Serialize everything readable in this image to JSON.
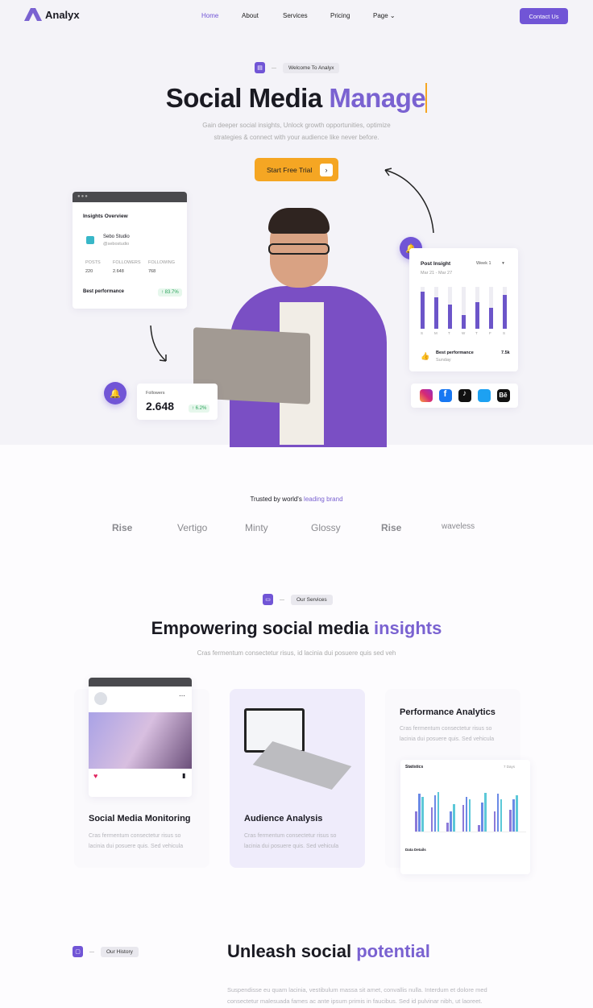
{
  "nav": {
    "brand": "Analyx",
    "items": [
      "Home",
      "About",
      "Services",
      "Pricing",
      "Page"
    ],
    "contact": "Contact Us"
  },
  "hero": {
    "badge": "Welcome To Analyx",
    "title_dark": "Social Media ",
    "title_accent": "Manage",
    "subtitle_line1": "Gain deeper social insights, Unlock growth opportunities, optimize",
    "subtitle_line2": "strategies & connect with your audience like never before.",
    "cta": "Start Free Trial"
  },
  "insights": {
    "title": "Insights Overview",
    "account": "Sebo Studio",
    "handle": "@sebostudio",
    "stats": [
      {
        "label": "POSTS",
        "value": "220"
      },
      {
        "label": "FOLLOWERS",
        "value": "2.648"
      },
      {
        "label": "FOLLOWING",
        "value": "768"
      }
    ],
    "best_label": "Best performance",
    "best_value": "↑ 83.7%"
  },
  "followers": {
    "label": "Followers",
    "value": "2.648",
    "change": "↑ 6.2%"
  },
  "post_insight": {
    "title": "Post Insight",
    "period": "Week 1",
    "dates": "Mar 21 - Mar 27",
    "days": [
      "S",
      "M",
      "T",
      "W",
      "T",
      "F",
      "S"
    ],
    "values": [
      0.88,
      0.75,
      0.58,
      0.32,
      0.64,
      0.5,
      0.8
    ],
    "best_label": "Best performance",
    "best_day": "Sunday",
    "best_value": "7.5k"
  },
  "social": [
    "Instagram",
    "Facebook",
    "TikTok",
    "Twitter",
    "Behance"
  ],
  "trusted": {
    "prefix": "Trusted by world's ",
    "accent": "leading brand",
    "brands": [
      "Rise",
      "Vertigo",
      "Minty",
      "Glossy",
      "Rise",
      "waveless"
    ]
  },
  "services": {
    "badge": "Our Services",
    "title_dark": "Empowering social media ",
    "title_accent": "insights",
    "subtitle": "Cras fermentum consectetur risus, id lacinia dui posuere quis sed veh",
    "cards": [
      {
        "title": "Social Media Monitoring",
        "text": "Cras fermentum consectetur risus so lacinia dui posuere quis. Sed vehicula"
      },
      {
        "title": "Audience Analysis",
        "text": "Cras fermentum consectetur risus so lacinia dui posuere quis. Sed vehicula"
      },
      {
        "title": "Performance Analytics",
        "text": "Cras fermentum consectetur risus so lacinia dui posuere quis. Sed vehicula"
      }
    ],
    "stats_widget": {
      "title": "Statistics",
      "range": "7 Days",
      "details": "Data Details",
      "series": [
        [
          0.45,
          0.55,
          0.2,
          0.6,
          0.15,
          0.45,
          0.5
        ],
        [
          0.85,
          0.82,
          0.45,
          0.78,
          0.65,
          0.85,
          0.72
        ],
        [
          0.78,
          0.9,
          0.62,
          0.72,
          0.88,
          0.72,
          0.82
        ]
      ]
    }
  },
  "history": {
    "badge": "Our History",
    "title_dark": "Unleash social ",
    "title_accent": "potential",
    "text_line1": "Suspendisse eu quam lacinia, vestibulum massa sit amet, convallis nulla. Interdum et dolore med",
    "text_line2": "consectetur malesuada fames ac ante ipsum primis in faucibus. Sed id pulvinar nibh, ut laoreet."
  },
  "colors": {
    "accent": "#7155d6",
    "cta": "#f5a623"
  }
}
